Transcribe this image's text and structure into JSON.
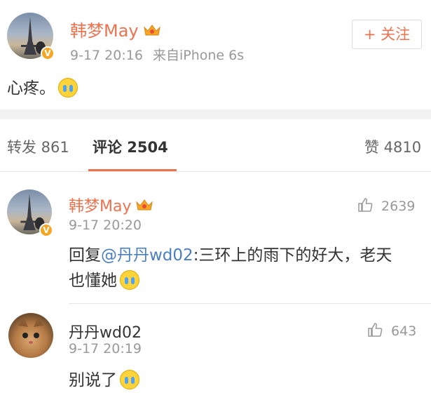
{
  "post": {
    "author": "韩梦May",
    "time": "9-17 20:16",
    "source": "来自iPhone 6s",
    "follow_label": "+ 关注",
    "text": "心疼。"
  },
  "tabs": {
    "repost": "转发 861",
    "comments": "评论 2504",
    "likes": "赞 4810"
  },
  "comments": [
    {
      "author": "韩梦May",
      "time": "9-17 20:20",
      "likes": "2639",
      "reply_prefix": "回复",
      "mention": "@丹丹wd02",
      "text": ":三环上的雨下的好大，老天",
      "text_line2": "也懂她"
    },
    {
      "author": "丹丹wd02",
      "time": "9-17 20:19",
      "likes": "643",
      "text": "别说了"
    }
  ],
  "colors": {
    "name": "#eb7350",
    "mention": "#4a7fbf",
    "tab_underline": "#eb7350",
    "verified_badge": "#f5a623"
  },
  "icons": [
    "verified-badge-icon",
    "crown-icon",
    "crying-emoji-icon",
    "thumbs-up-icon"
  ]
}
